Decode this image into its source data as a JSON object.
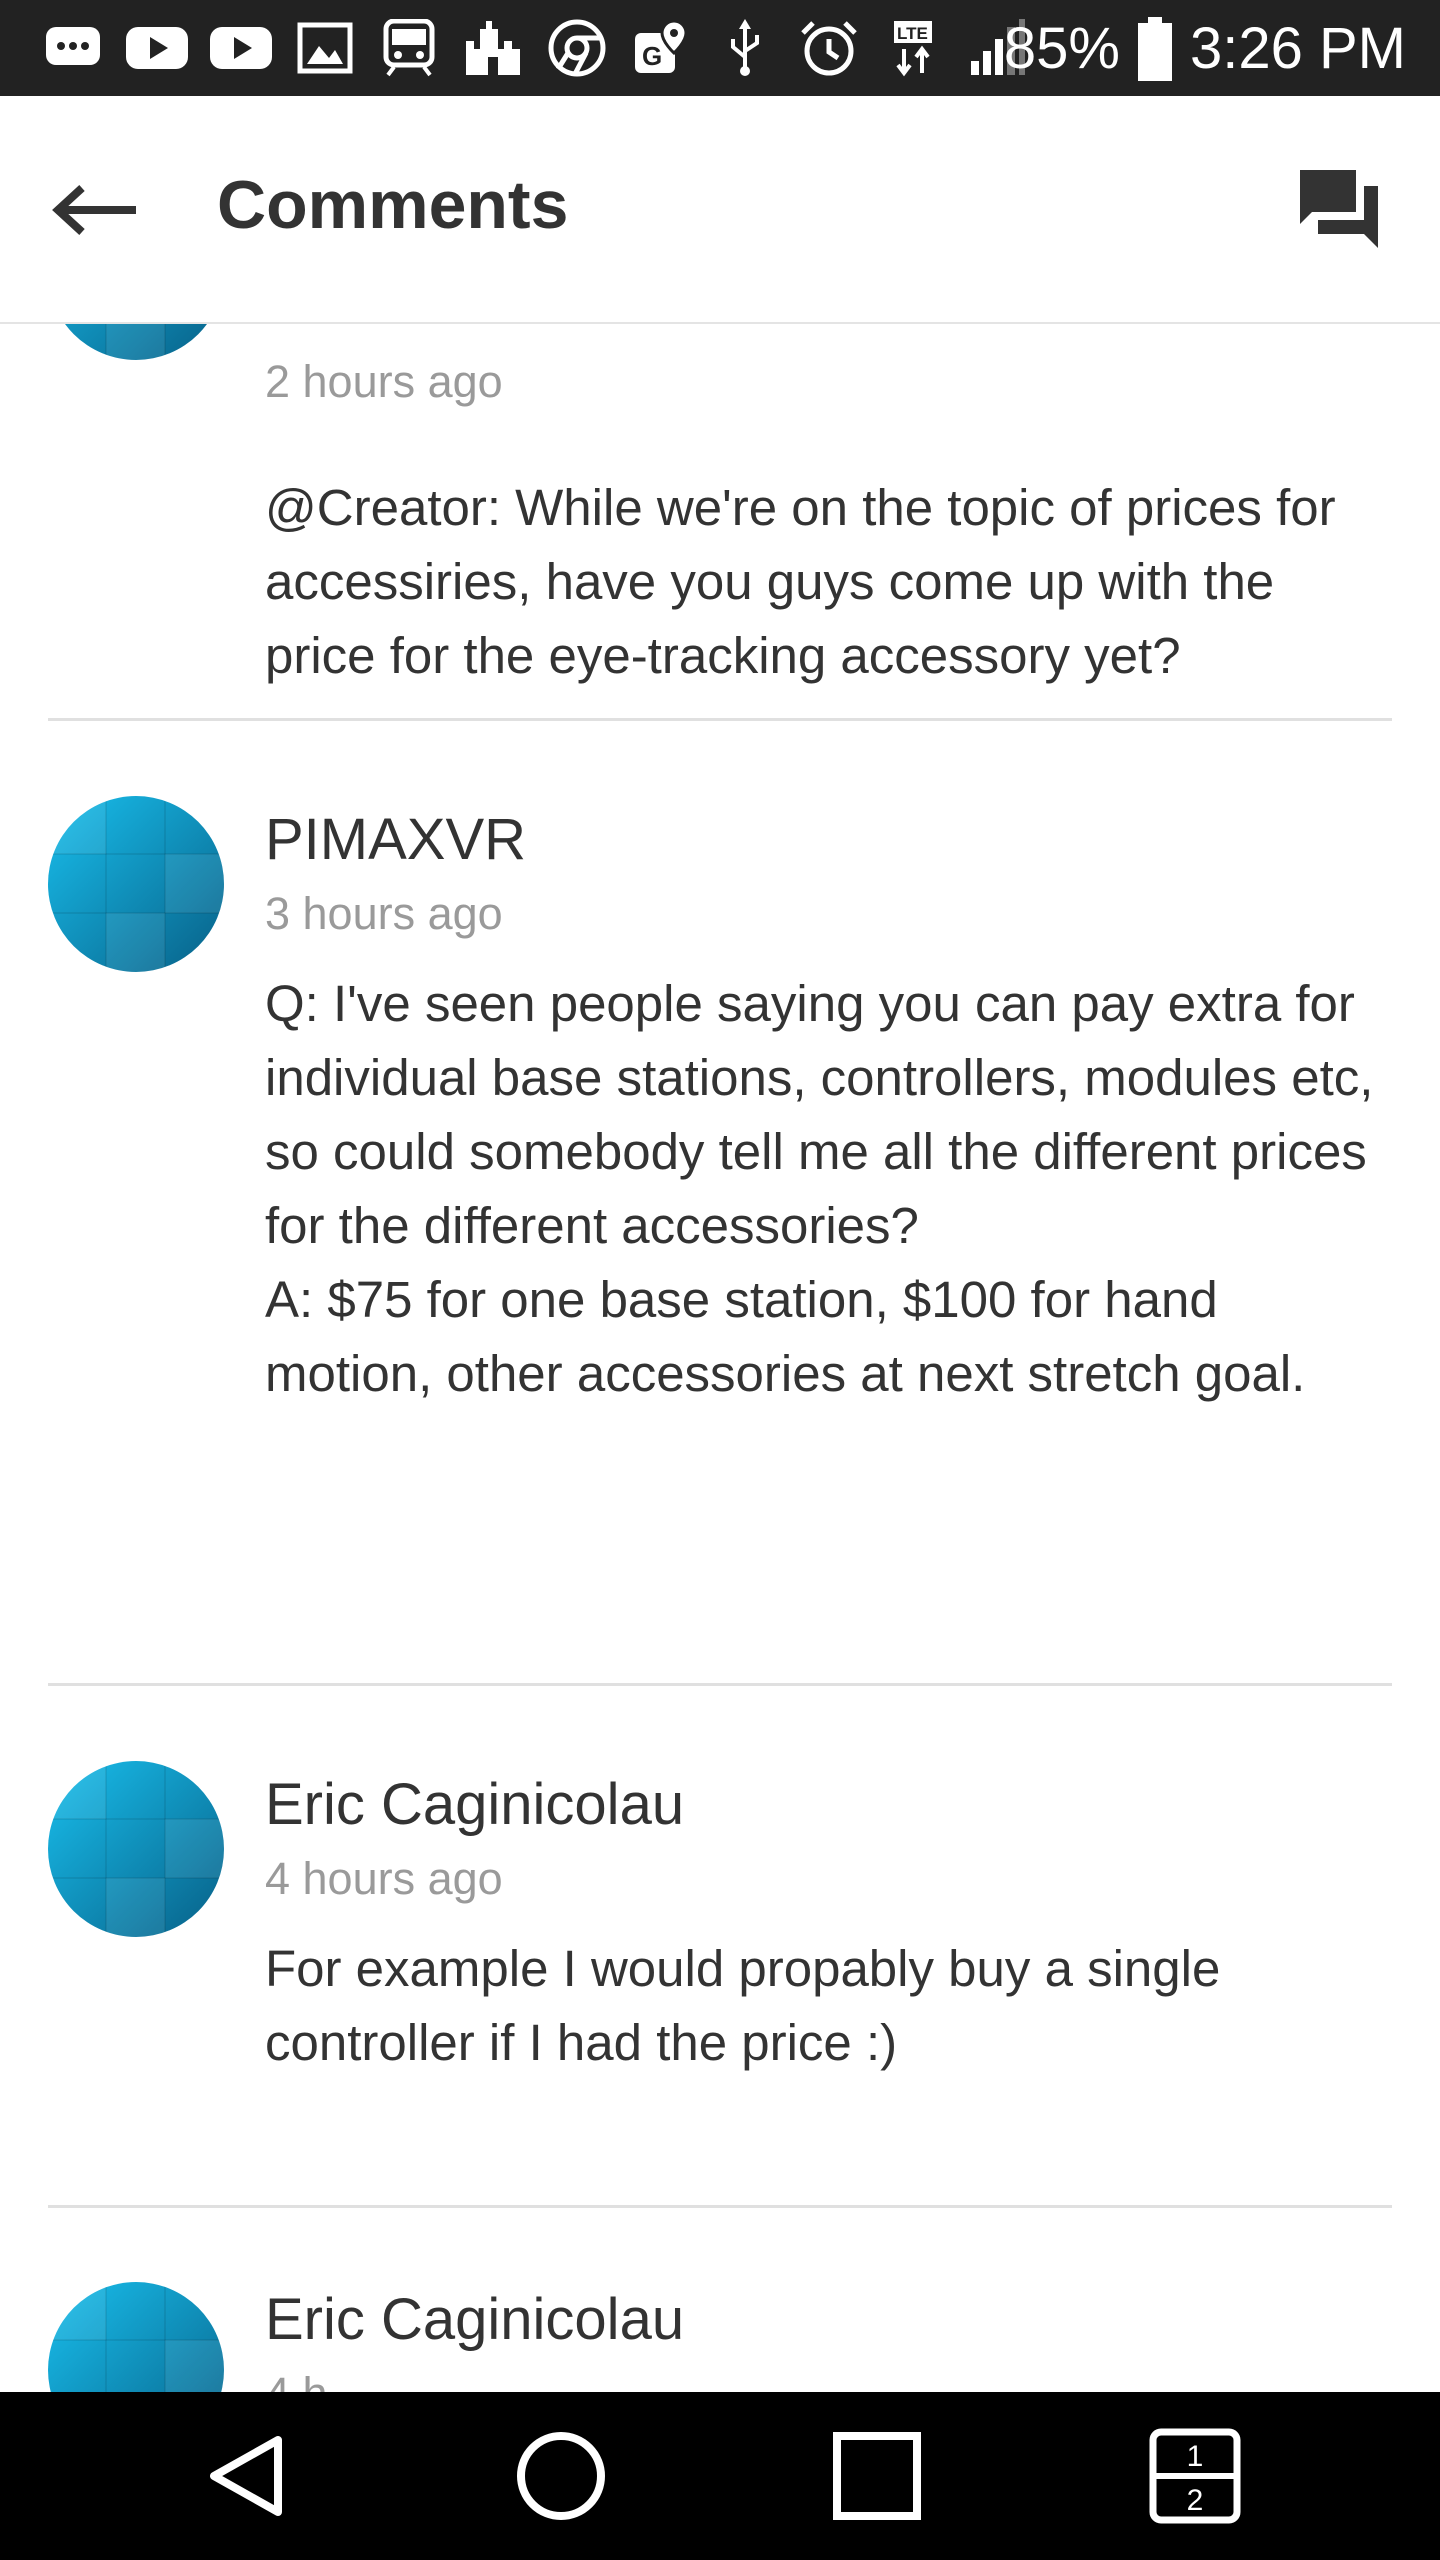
{
  "status_bar": {
    "icons": [
      "messaging-icon",
      "youtube-icon",
      "youtube-icon",
      "gallery-icon",
      "transit-icon",
      "castle-icon",
      "chrome-icon",
      "maps-icon",
      "usb-icon",
      "alarm-icon",
      "lte-icon",
      "signal-icon"
    ],
    "lte_label": "LTE",
    "battery": "85%",
    "time": "3:26 PM"
  },
  "app_bar": {
    "title": "Comments"
  },
  "comments": [
    {
      "time": "2 hours ago",
      "body": "@Creator: While we're on the topic of prices for accessiries, have you guys come up with the price for the eye-tracking accessory yet?"
    },
    {
      "author": "PIMAXVR",
      "time": "3 hours ago",
      "body": "Q: I've seen people saying you can pay extra for individual base stations, controllers, modules etc, so could somebody tell me all the different prices for the different accessories?\nA: $75 for one base station, $100 for hand motion, other accessories at next stretch goal."
    },
    {
      "author": "Eric Caginicolau",
      "time": "4 hours ago",
      "body": "For example I would propably buy a single controller if I had the price :)"
    },
    {
      "author": "Eric Caginicolau",
      "time": "4 h"
    }
  ],
  "nav_bar": {
    "dual_window_top": "1",
    "dual_window_bottom": "2"
  },
  "colors": {
    "avatar_light": "#16b4e4",
    "avatar_dark": "#0a6a92",
    "status_bar": "#222222",
    "nav_bar": "#000000"
  }
}
